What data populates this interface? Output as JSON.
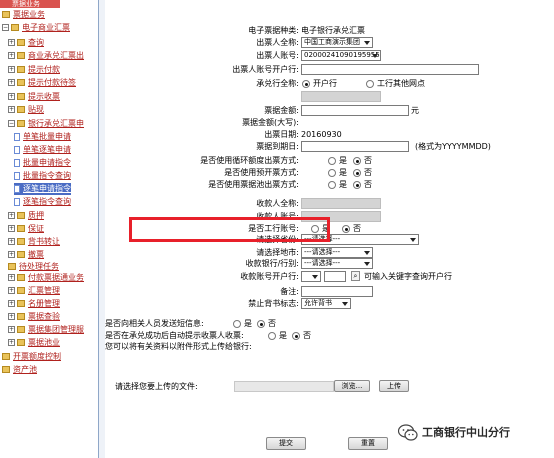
{
  "sidebar": {
    "top_label": "票据业务",
    "items": [
      {
        "label": "票据业务",
        "type": "plain"
      },
      {
        "label": "电子商业汇票",
        "type": "open"
      },
      {
        "label": "查询",
        "type": "closed"
      },
      {
        "label": "商业承兑汇票出",
        "type": "closed"
      },
      {
        "label": "提示付款",
        "type": "closed"
      },
      {
        "label": "提示付款待签",
        "type": "closed"
      },
      {
        "label": "提示收票",
        "type": "closed"
      },
      {
        "label": "贴现",
        "type": "closed"
      },
      {
        "label": "银行承兑汇票申",
        "type": "open"
      },
      {
        "label": "单笔批量申请",
        "type": "doc"
      },
      {
        "label": "单笔逐笔申请",
        "type": "doc"
      },
      {
        "label": "批量申请指令",
        "type": "doc"
      },
      {
        "label": "批量指令查询",
        "type": "doc"
      },
      {
        "label": "逐笔申请指令",
        "type": "doc",
        "active": true
      },
      {
        "label": "逐笔指令查询",
        "type": "doc"
      },
      {
        "label": "质押",
        "type": "closed"
      },
      {
        "label": "保证",
        "type": "closed"
      },
      {
        "label": "背书转让",
        "type": "closed"
      },
      {
        "label": "撤票",
        "type": "closed"
      },
      {
        "label": "待处理任务",
        "type": "plain"
      },
      {
        "label": "付款票据通业务",
        "type": "closed"
      },
      {
        "label": "汇票管理",
        "type": "closed"
      },
      {
        "label": "名册管理",
        "type": "closed"
      },
      {
        "label": "票据查验",
        "type": "closed"
      },
      {
        "label": "票据集团管理服",
        "type": "closed"
      },
      {
        "label": "票据池业",
        "type": "closed"
      },
      {
        "label": "开票额度控制",
        "type": "plain"
      },
      {
        "label": "资产池",
        "type": "plain"
      }
    ]
  },
  "form": {
    "bill_type_label": "电子票据种类:",
    "bill_type_value": "电子银行承兑汇票",
    "drawer_name_label": "出票人全称:",
    "drawer_name_value": "中国工商演示集团",
    "drawer_account_label": "出票人账号:",
    "drawer_account_value": "0200024109019595588",
    "drawer_bank_label": "出票人账号开户行:",
    "drawer_bank_value": "",
    "acceptor_label": "承兑行全称:",
    "acceptor_opt1": "开户行",
    "acceptor_opt2": "工行其他网点",
    "amount_label": "票据金额:",
    "amount_unit": "元",
    "amount_upper_label": "票据金额(大写):",
    "issue_date_label": "出票日期:",
    "issue_date_value": "20160930",
    "due_date_label": "票据到期日:",
    "due_date_hint": "(格式为YYYYMMDD)",
    "q1_label": "是否使用循环额度出票方式:",
    "q2_label": "是否使用预开票方式:",
    "q3_label": "是否使用票据池出票方式:",
    "yes": "是",
    "no": "否",
    "payee_name_label": "收款人全称:",
    "payee_account_label": "收款人账号:",
    "is_icbc_label": "是否工行账号:",
    "province_label": "请选择省份:",
    "province_value": "---请选择---",
    "city_label": "请选择地市:",
    "city_value": "---请选择---",
    "branch_label": "收款银行/行别:",
    "branch_value": "---请选择---",
    "payee_bank_label": "收款账号开户行:",
    "payee_bank_hint": "可输入关键字查询开户行",
    "remark_label": "备注:",
    "no_endorse_label": "禁止背书标志:",
    "no_endorse_value": "允许背书",
    "notify_label": "是否向相关人员发送短信息:",
    "auto_prompt_label": "是否在承兑成功后自动提示收票人收票:",
    "upload_note": "您可以将有关资料以附件形式上传给银行:",
    "upload_label": "请选择您要上传的文件:",
    "browse": "浏览...",
    "upload": "上传",
    "submit": "提交",
    "reset": "重置"
  },
  "watermark": {
    "text": "工商银行中山分行"
  },
  "colors": {
    "highlight": "#e8202a",
    "link": "#b0221e",
    "active_bg": "#4a6cc4"
  }
}
